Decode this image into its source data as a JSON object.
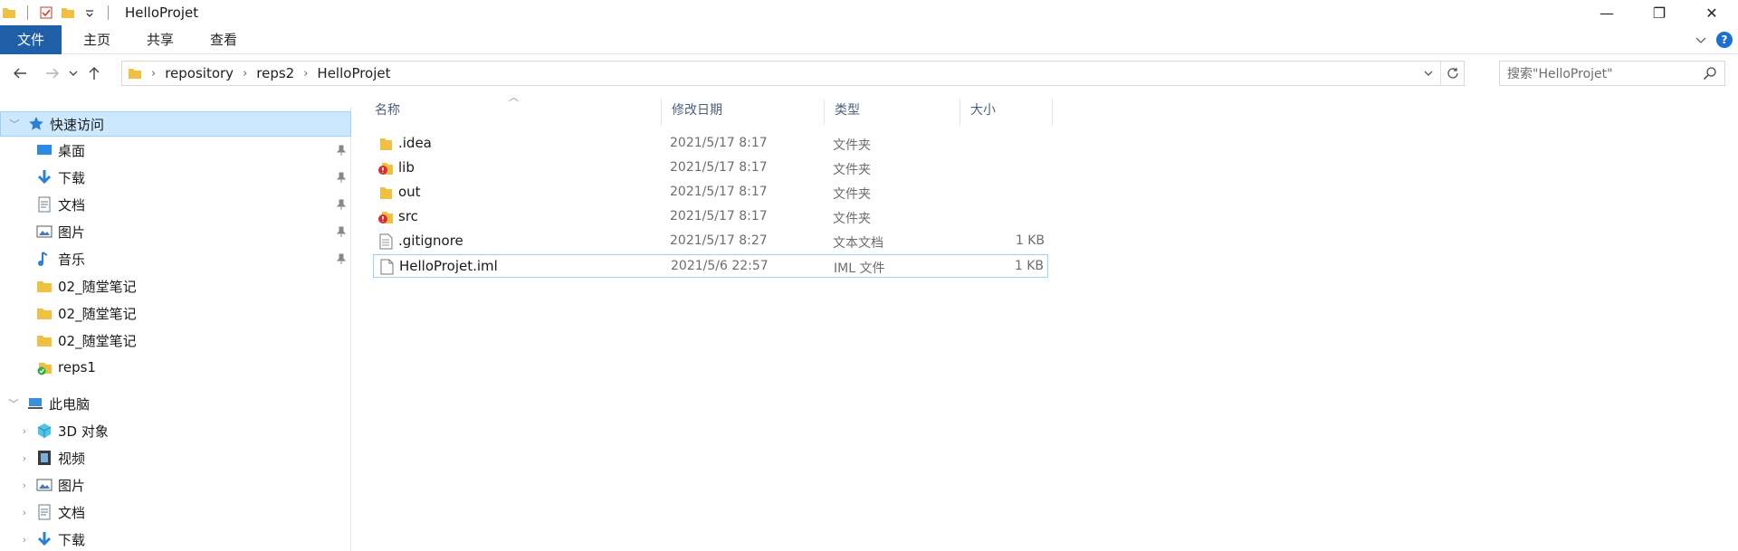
{
  "window": {
    "title": "HelloProjet",
    "minimize_glyph": "—",
    "restore_glyph": "❐",
    "close_glyph": "✕"
  },
  "ribbon": {
    "tabs": [
      {
        "label": "文件",
        "active": true
      },
      {
        "label": "主页"
      },
      {
        "label": "共享"
      },
      {
        "label": "查看"
      }
    ],
    "help_label": "?"
  },
  "address": {
    "crumbs": [
      "repository",
      "reps2",
      "HelloProjet"
    ],
    "search_placeholder": "搜索\"HelloProjet\""
  },
  "nav": {
    "quick_access_label": "快速访问",
    "items": [
      {
        "label": "桌面",
        "icon": "desktop-icon",
        "pinned": true
      },
      {
        "label": "下载",
        "icon": "download-icon",
        "pinned": true
      },
      {
        "label": "文档",
        "icon": "documents-icon",
        "pinned": true
      },
      {
        "label": "图片",
        "icon": "pictures-icon",
        "pinned": true
      },
      {
        "label": "音乐",
        "icon": "music-icon",
        "pinned": true
      },
      {
        "label": "02_随堂笔记",
        "icon": "folder-icon"
      },
      {
        "label": "02_随堂笔记",
        "icon": "folder-icon"
      },
      {
        "label": "02_随堂笔记",
        "icon": "folder-icon"
      },
      {
        "label": "reps1",
        "icon": "git-clean-folder-icon"
      }
    ],
    "this_pc_label": "此电脑",
    "pc_items": [
      {
        "label": "3D 对象",
        "icon": "3d-objects-icon"
      },
      {
        "label": "视频",
        "icon": "videos-icon"
      },
      {
        "label": "图片",
        "icon": "pictures-icon"
      },
      {
        "label": "文档",
        "icon": "documents-icon"
      },
      {
        "label": "下载",
        "icon": "download-icon"
      }
    ]
  },
  "columns": {
    "name": "名称",
    "date": "修改日期",
    "type": "类型",
    "size": "大小"
  },
  "files": [
    {
      "name": ".idea",
      "date": "2021/5/17 8:17",
      "type": "文件夹",
      "size": "",
      "icon": "folder-icon"
    },
    {
      "name": "lib",
      "date": "2021/5/17 8:17",
      "type": "文件夹",
      "size": "",
      "icon": "git-modified-folder-icon"
    },
    {
      "name": "out",
      "date": "2021/5/17 8:17",
      "type": "文件夹",
      "size": "",
      "icon": "folder-icon"
    },
    {
      "name": "src",
      "date": "2021/5/17 8:17",
      "type": "文件夹",
      "size": "",
      "icon": "git-modified-folder-icon"
    },
    {
      "name": ".gitignore",
      "date": "2021/5/17 8:27",
      "type": "文本文档",
      "size": "1 KB",
      "icon": "text-file-icon"
    },
    {
      "name": "HelloProjet.iml",
      "date": "2021/5/6 22:57",
      "type": "IML 文件",
      "size": "1 KB",
      "icon": "file-icon"
    }
  ],
  "colors": {
    "accent": "#1f5fa8",
    "selection": "#cce8ff",
    "folder": "#f0c040"
  }
}
